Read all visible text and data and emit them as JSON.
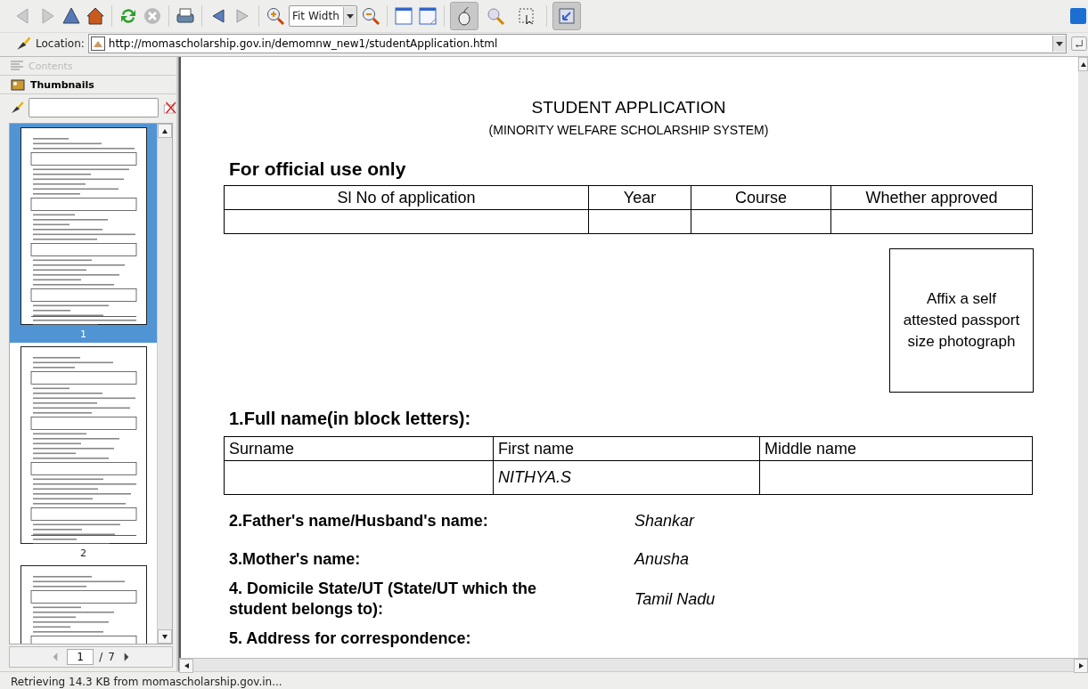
{
  "toolbar": {
    "zoom_mode": "Fit Width",
    "tools": [
      {
        "kind": "browse",
        "selected": true
      },
      {
        "kind": "zoom",
        "selected": false
      },
      {
        "kind": "select",
        "selected": false
      }
    ],
    "sidebar_toggle": {
      "on": true
    }
  },
  "location": {
    "label": "Location:",
    "url": "http://momascholarship.gov.in/demomnw_new1/studentApplication.html"
  },
  "sidebar": {
    "tabs": [
      {
        "label": "Contents",
        "selected": false,
        "disabled": true
      },
      {
        "label": "Thumbnails",
        "selected": true,
        "disabled": false
      }
    ],
    "thumbnails": [
      {
        "label": "1",
        "selected": true,
        "kind": "page1"
      },
      {
        "label": "2",
        "selected": false,
        "kind": "page2"
      },
      {
        "selected": false,
        "kind": "page3"
      }
    ],
    "page_nav": {
      "current": "1",
      "separator": "/",
      "total": "7"
    }
  },
  "document": {
    "title": "STUDENT APPLICATION",
    "subtitle": "(MINORITY WELFARE SCHOLARSHIP SYSTEM)",
    "official": {
      "heading": "For official use only",
      "columns": [
        "Sl No of application",
        "Year",
        "Course",
        "Whether approved"
      ]
    },
    "photo_box": "Affix a self attested passport size photograph",
    "full_name": {
      "heading": "1.Full name(in block letters):",
      "columns": [
        {
          "label": "Surname"
        },
        {
          "label": "First name",
          "value": "NITHYA.S"
        },
        {
          "label": "Middle name"
        }
      ]
    },
    "fields": [
      {
        "label": "2.Father's name/Husband's name:",
        "value": "Shankar"
      },
      {
        "label": "3.Mother's name:",
        "value": "Anusha"
      },
      {
        "label": "4. Domicile State/UT (State/UT which the student belongs to):",
        "value": "Tamil Nadu"
      }
    ],
    "next_heading": "5. Address for correspondence:"
  },
  "status_bar": "Retrieving 14.3 KB from momascholarship.gov.in..."
}
